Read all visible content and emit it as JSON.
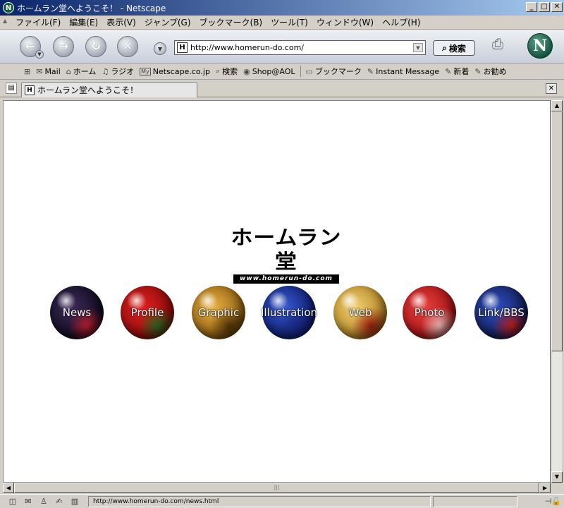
{
  "window": {
    "title": "ホームラン堂へようこそ！ - Netscape",
    "app_icon": "N",
    "controls": [
      "_",
      "□",
      "✕"
    ]
  },
  "menu": [
    "ファイル(F)",
    "編集(E)",
    "表示(V)",
    "ジャンプ(G)",
    "ブックマーク(B)",
    "ツール(T)",
    "ウィンドウ(W)",
    "ヘルプ(H)"
  ],
  "nav": {
    "back_icon": "←",
    "forward_icon": "→",
    "reload_icon": "↻",
    "stop_icon": "✕",
    "url": "http://www.homerun-do.com/",
    "site_icon": "H",
    "search_label": "検索",
    "logo_letter": "N"
  },
  "personal_toolbar": {
    "items": [
      {
        "icon": "✉",
        "label": "Mail"
      },
      {
        "icon": "⌂",
        "label": "ホーム"
      },
      {
        "icon": "♫",
        "label": "ラジオ"
      },
      {
        "icon": "My",
        "label": "Netscape.co.jp"
      },
      {
        "icon": "⌕",
        "label": "検索"
      },
      {
        "icon": "◉",
        "label": "Shop@AOL"
      }
    ],
    "items2": [
      {
        "icon": "▭",
        "label": "ブックマーク"
      },
      {
        "icon": "✎",
        "label": "Instant Message"
      },
      {
        "icon": "✎",
        "label": "新着"
      },
      {
        "icon": "✎",
        "label": "お勧め"
      }
    ]
  },
  "tab": {
    "label": "ホームラン堂へようこそ！",
    "icon": "H"
  },
  "page": {
    "logo_text": "ホームラン堂",
    "logo_sub": "www.homerun-do.com",
    "balls": [
      {
        "label": "News",
        "colors": [
          "#3d2a5a",
          "#0d0a1a",
          "#c02030"
        ]
      },
      {
        "label": "Profile",
        "colors": [
          "#e02020",
          "#8a0a0a",
          "#2a6a20"
        ]
      },
      {
        "label": "Graphic",
        "colors": [
          "#e8b040",
          "#8a5a10",
          "#5a3a08"
        ]
      },
      {
        "label": "Illustration",
        "colors": [
          "#3a5ad0",
          "#0a1a6a",
          "#1a2a8a"
        ]
      },
      {
        "label": "Web",
        "colors": [
          "#f0d070",
          "#b08020",
          "#a02010"
        ]
      },
      {
        "label": "Photo",
        "colors": [
          "#e84040",
          "#a01010",
          "#f0c0c0"
        ]
      },
      {
        "label": "Link/BBS",
        "colors": [
          "#3050c0",
          "#101a50",
          "#c02020"
        ]
      }
    ]
  },
  "status": {
    "text": "http://www.homerun-do.com/news.html"
  }
}
